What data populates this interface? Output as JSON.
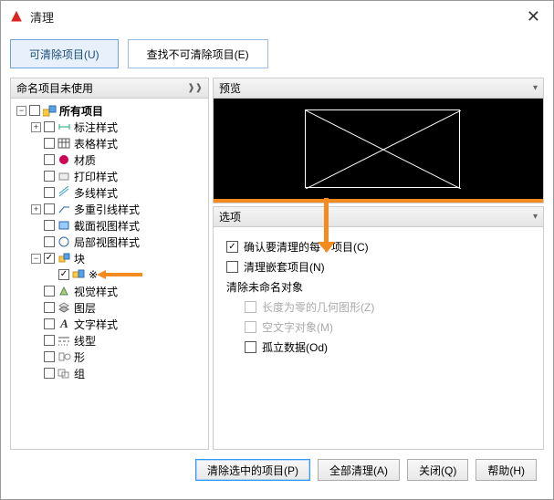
{
  "window": {
    "title": "清理"
  },
  "tabs": {
    "purgeable": "可清除项目(U)",
    "nonpurgeable": "查找不可清除项目(E)"
  },
  "leftPanel": {
    "header": "命名项目未使用"
  },
  "tree": {
    "root": "所有项目",
    "items": [
      "标注样式",
      "表格样式",
      "材质",
      "打印样式",
      "多线样式",
      "多重引线样式",
      "截面视图样式",
      "局部视图样式",
      "块",
      "视觉样式",
      "图层",
      "文字样式",
      "线型",
      "形",
      "组"
    ],
    "blockChild": "※"
  },
  "preview": {
    "header": "预览"
  },
  "options": {
    "header": "选项",
    "confirm": "确认要清理的每个项目(C)",
    "nested": "清理嵌套项目(N)",
    "unnamed_header": "清除未命名对象",
    "zero_geom": "长度为零的几何图形(Z)",
    "empty_text": "空文字对象(M)",
    "orphan": "孤立数据(Od)"
  },
  "footer": {
    "purge_selected": "清除选中的项目(P)",
    "purge_all": "全部清理(A)",
    "close": "关闭(Q)",
    "help": "帮助(H)"
  }
}
